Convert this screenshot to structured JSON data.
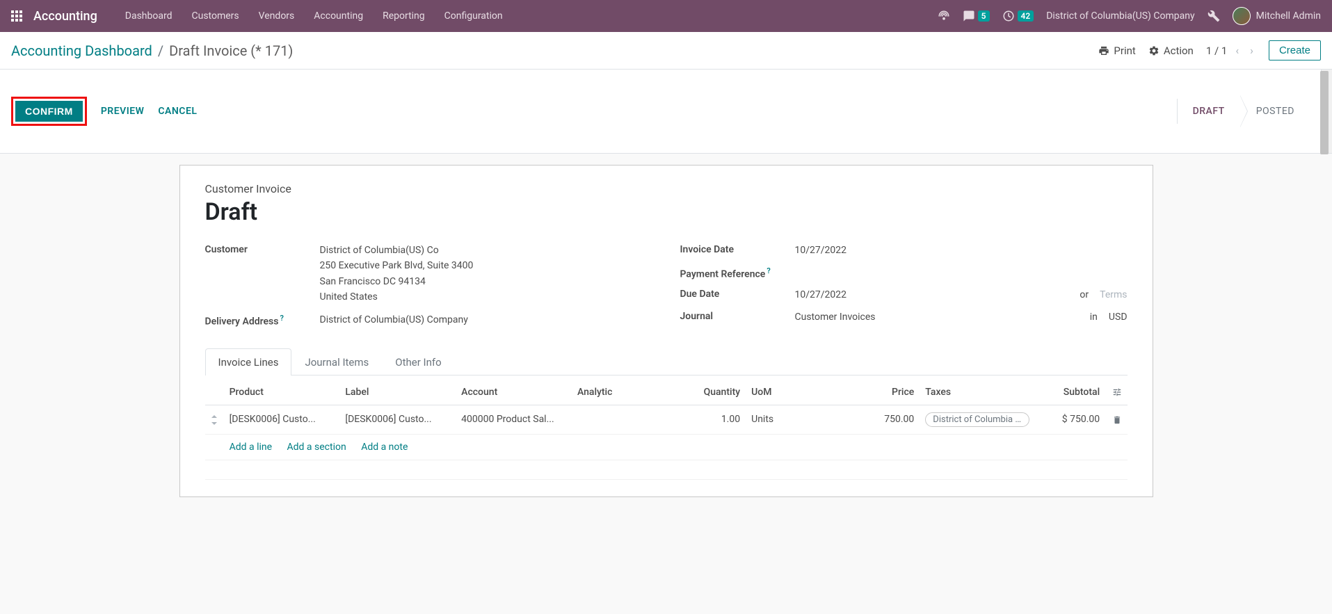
{
  "navbar": {
    "brand": "Accounting",
    "menu": [
      "Dashboard",
      "Customers",
      "Vendors",
      "Accounting",
      "Reporting",
      "Configuration"
    ],
    "messages_badge": "5",
    "activities_badge": "42",
    "company": "District of Columbia(US) Company",
    "user": "Mitchell Admin"
  },
  "breadcrumb": {
    "parent": "Accounting Dashboard",
    "current": "Draft Invoice (* 171)"
  },
  "controls": {
    "print": "Print",
    "action": "Action",
    "pager": "1 / 1",
    "create": "Create"
  },
  "statusbar": {
    "confirm": "CONFIRM",
    "preview": "PREVIEW",
    "cancel": "CANCEL",
    "steps": {
      "draft": "DRAFT",
      "posted": "POSTED"
    }
  },
  "form": {
    "type_label": "Customer Invoice",
    "title": "Draft",
    "labels": {
      "customer": "Customer",
      "delivery_address": "Delivery Address",
      "invoice_date": "Invoice Date",
      "payment_reference": "Payment Reference",
      "due_date": "Due Date",
      "journal": "Journal",
      "or": "or",
      "in": "in",
      "terms_placeholder": "Terms"
    },
    "customer": {
      "name": "District of Columbia(US) Co",
      "street": "250 Executive Park Blvd, Suite 3400",
      "city_line": "San Francisco DC 94134",
      "country": "United States"
    },
    "delivery_address": "District of Columbia(US) Company",
    "invoice_date": "10/27/2022",
    "payment_reference": "",
    "due_date": "10/27/2022",
    "journal": "Customer Invoices",
    "currency": "USD"
  },
  "tabs": [
    "Invoice Lines",
    "Journal Items",
    "Other Info"
  ],
  "table": {
    "headers": {
      "product": "Product",
      "label": "Label",
      "account": "Account",
      "analytic": "Analytic",
      "quantity": "Quantity",
      "uom": "UoM",
      "price": "Price",
      "taxes": "Taxes",
      "subtotal": "Subtotal"
    },
    "rows": [
      {
        "product": "[DESK0006] Custo...",
        "label": "[DESK0006] Custo...",
        "account": "400000 Product Sal...",
        "analytic": "",
        "quantity": "1.00",
        "uom": "Units",
        "price": "750.00",
        "taxes": "District of Columbia Sa",
        "subtotal": "$ 750.00"
      }
    ],
    "add_line": "Add a line",
    "add_section": "Add a section",
    "add_note": "Add a note"
  }
}
